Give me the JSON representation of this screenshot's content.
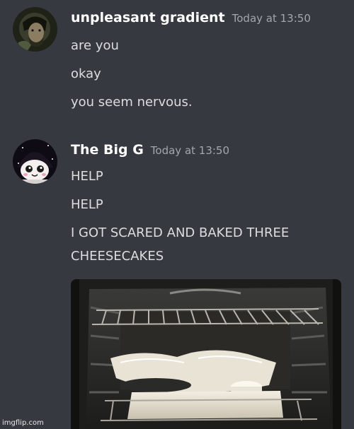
{
  "messages": [
    {
      "author": "unpleasant gradient",
      "timestamp": "Today at 13:50",
      "lines": [
        "are you",
        "okay",
        "you seem nervous."
      ]
    },
    {
      "author": "The Big G",
      "timestamp": "Today at 13:50",
      "lines": [
        "HELP",
        "HELP",
        "I GOT SCARED AND BAKED THREE",
        "CHEESECAKES"
      ]
    }
  ],
  "watermark": "imgflip.com",
  "colors": {
    "background": "#36393f",
    "author": "#ffffff",
    "timestamp": "#a3a6aa",
    "message_text": "#dcddde"
  }
}
